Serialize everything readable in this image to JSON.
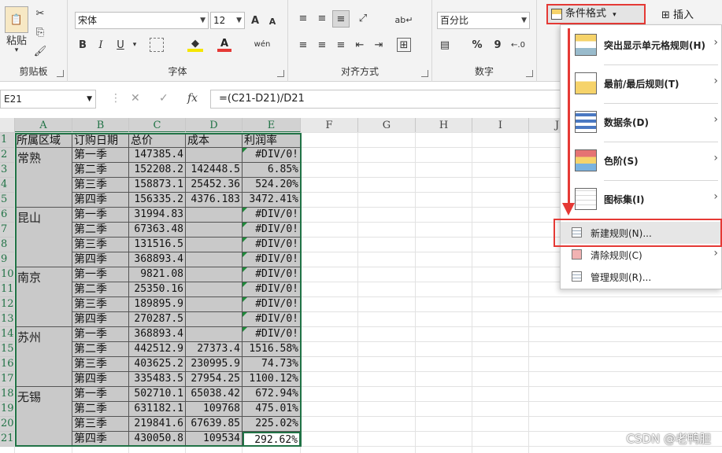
{
  "ribbon": {
    "clipboard": {
      "paste_label": "粘贴",
      "group_label": "剪贴板"
    },
    "font": {
      "font_name": "宋体",
      "font_size": "12",
      "group_label": "字体",
      "grow_label": "A",
      "shrink_label": "A",
      "bold": "B",
      "italic": "I",
      "underline": "U",
      "color_a": "A",
      "wen": "wén"
    },
    "alignment": {
      "group_label": "对齐方式"
    },
    "number": {
      "format": "百分比",
      "group_label": "数字",
      "percent": "%",
      "comma": "9"
    },
    "conditional_format_label": "条件格式",
    "insert_label": "插入"
  },
  "formula_bar": {
    "name_box": "E21",
    "cancel": "✕",
    "confirm": "✓",
    "fx": "fx",
    "formula": "=(C21-D21)/D21"
  },
  "columns": [
    "A",
    "B",
    "C",
    "D",
    "E",
    "F",
    "G",
    "H",
    "I",
    "J"
  ],
  "rows": [
    "1",
    "2",
    "3",
    "4",
    "5",
    "6",
    "7",
    "8",
    "9",
    "10",
    "11",
    "12",
    "13",
    "14",
    "15",
    "16",
    "17",
    "18",
    "19",
    "20",
    "21"
  ],
  "headers": [
    "所属区域",
    "订购日期",
    "总价",
    "成本",
    "利润率"
  ],
  "regions": [
    "常熟",
    "昆山",
    "南京",
    "苏州",
    "无锡"
  ],
  "table": [
    [
      "第一季",
      "147385.4",
      "",
      "#DIV/0!"
    ],
    [
      "第二季",
      "152208.2",
      "142448.5",
      "6.85%"
    ],
    [
      "第三季",
      "158873.1",
      "25452.36",
      "524.20%"
    ],
    [
      "第四季",
      "156335.2",
      "4376.183",
      "3472.41%"
    ],
    [
      "第一季",
      "31994.83",
      "",
      "#DIV/0!"
    ],
    [
      "第二季",
      "67363.48",
      "",
      "#DIV/0!"
    ],
    [
      "第三季",
      "131516.5",
      "",
      "#DIV/0!"
    ],
    [
      "第四季",
      "368893.4",
      "",
      "#DIV/0!"
    ],
    [
      "第一季",
      "9821.08",
      "",
      "#DIV/0!"
    ],
    [
      "第二季",
      "25350.16",
      "",
      "#DIV/0!"
    ],
    [
      "第三季",
      "189895.9",
      "",
      "#DIV/0!"
    ],
    [
      "第四季",
      "270287.5",
      "",
      "#DIV/0!"
    ],
    [
      "第一季",
      "368893.4",
      "",
      "#DIV/0!"
    ],
    [
      "第二季",
      "442512.9",
      "27373.4",
      "1516.58%"
    ],
    [
      "第三季",
      "403625.2",
      "230995.9",
      "74.73%"
    ],
    [
      "第四季",
      "335483.5",
      "27954.25",
      "1100.12%"
    ],
    [
      "第一季",
      "502710.1",
      "65038.42",
      "672.94%"
    ],
    [
      "第二季",
      "631182.1",
      "109768",
      "475.01%"
    ],
    [
      "第三季",
      "219841.6",
      "67639.85",
      "225.02%"
    ],
    [
      "第四季",
      "430050.8",
      "109534",
      "292.62%"
    ]
  ],
  "menu": {
    "items_big": [
      {
        "label": "突出显示单元格规则(H)"
      },
      {
        "label": "最前/最后规则(T)"
      },
      {
        "label": "数据条(D)"
      },
      {
        "label": "色阶(S)"
      },
      {
        "label": "图标集(I)"
      }
    ],
    "new_rule": "新建规则(N)...",
    "clear_rules": "清除规则(C)",
    "manage_rules": "管理规则(R)..."
  },
  "watermark": "CSDN @老鸭胆"
}
